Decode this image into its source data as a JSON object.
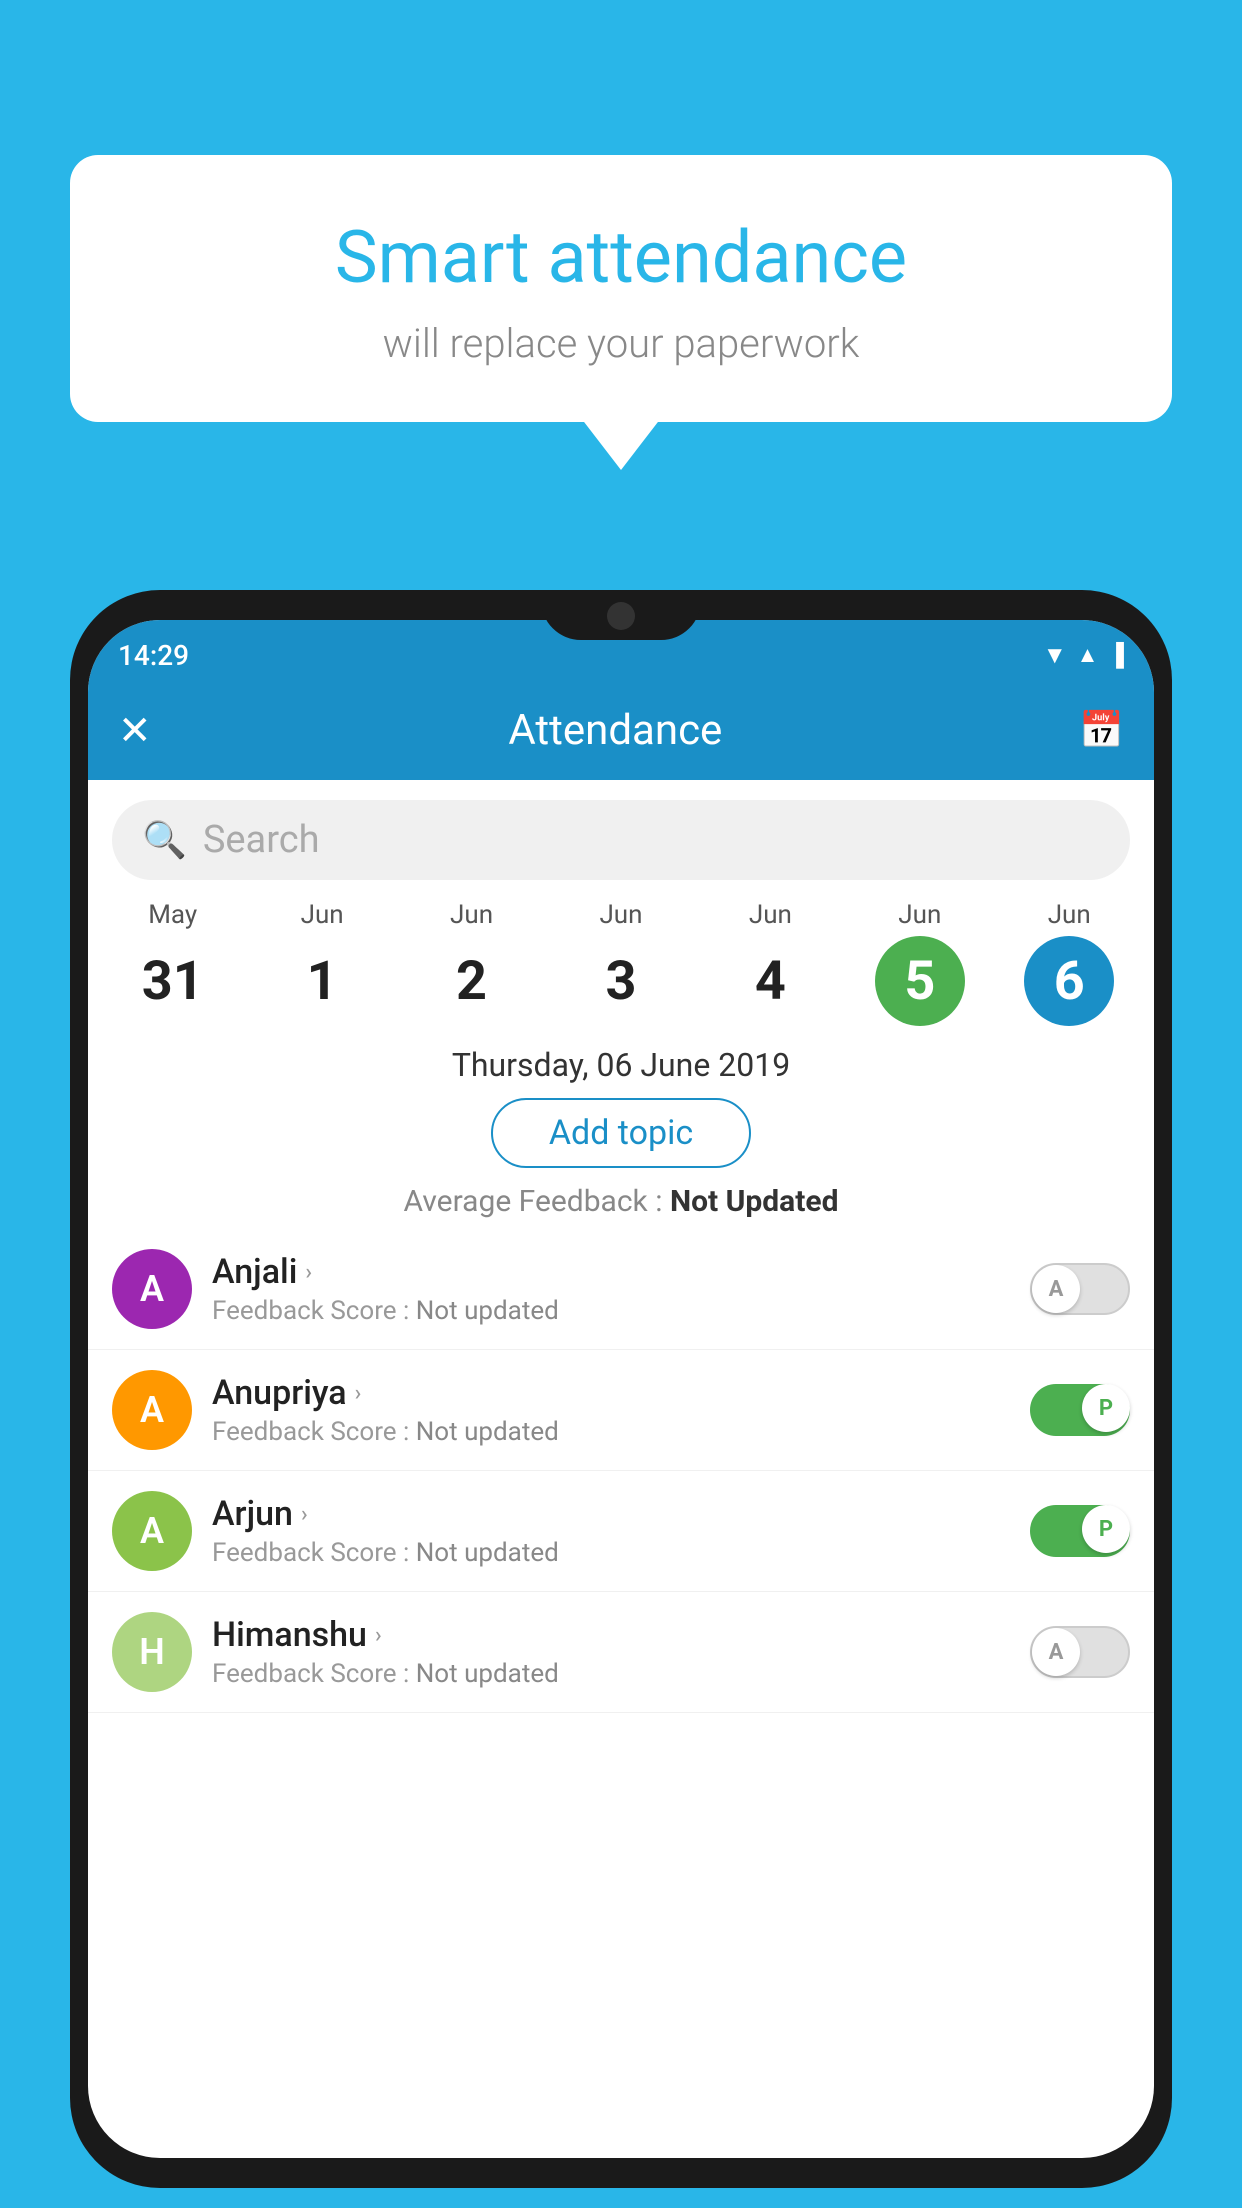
{
  "background_color": "#29b6e8",
  "speech_bubble": {
    "title": "Smart attendance",
    "subtitle": "will replace your paperwork"
  },
  "phone": {
    "status_bar": {
      "time": "14:29",
      "wifi_icon": "wifi",
      "signal_icon": "signal",
      "battery_icon": "battery"
    },
    "header": {
      "title": "Attendance",
      "close_label": "✕",
      "calendar_icon": "📅"
    },
    "search": {
      "placeholder": "Search"
    },
    "dates": [
      {
        "month": "May",
        "day": "31",
        "state": "normal"
      },
      {
        "month": "Jun",
        "day": "1",
        "state": "normal"
      },
      {
        "month": "Jun",
        "day": "2",
        "state": "normal"
      },
      {
        "month": "Jun",
        "day": "3",
        "state": "normal"
      },
      {
        "month": "Jun",
        "day": "4",
        "state": "normal"
      },
      {
        "month": "Jun",
        "day": "5",
        "state": "today"
      },
      {
        "month": "Jun",
        "day": "6",
        "state": "selected"
      }
    ],
    "selected_date_label": "Thursday, 06 June 2019",
    "add_topic_label": "Add topic",
    "avg_feedback_label": "Average Feedback :",
    "avg_feedback_value": "Not Updated",
    "students": [
      {
        "name": "Anjali",
        "avatar_letter": "A",
        "avatar_color": "#9c27b0",
        "feedback_label": "Feedback Score :",
        "feedback_value": "Not updated",
        "attendance": "absent",
        "toggle_label": "A"
      },
      {
        "name": "Anupriya",
        "avatar_letter": "A",
        "avatar_color": "#ff9800",
        "feedback_label": "Feedback Score :",
        "feedback_value": "Not updated",
        "attendance": "present",
        "toggle_label": "P"
      },
      {
        "name": "Arjun",
        "avatar_letter": "A",
        "avatar_color": "#8bc34a",
        "feedback_label": "Feedback Score :",
        "feedback_value": "Not updated",
        "attendance": "present",
        "toggle_label": "P"
      },
      {
        "name": "Himanshu",
        "avatar_letter": "H",
        "avatar_color": "#aed581",
        "feedback_label": "Feedback Score :",
        "feedback_value": "Not updated",
        "attendance": "absent",
        "toggle_label": "A"
      }
    ]
  }
}
